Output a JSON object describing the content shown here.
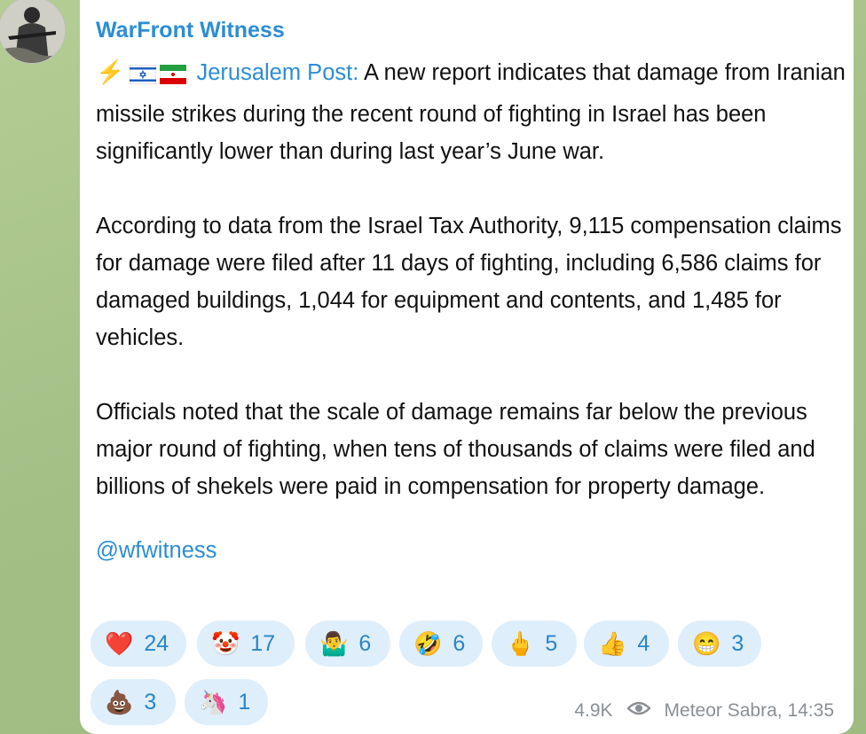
{
  "channel": {
    "name": "WarFront Witness"
  },
  "post": {
    "bolt": "⚡",
    "source": "Jerusalem Post:",
    "p1_rest": " A new report indicates that damage from Iranian missile strikes during the recent round of fighting in Israel has been significantly lower than during last year’s June war.",
    "p2": "According to data from the Israel Tax Authority, 9,115 compensation claims for damage were filed after 11 days of fighting, including 6,586 claims for damaged buildings, 1,044 for equipment and contents, and 1,485 for vehicles.",
    "p3": "Officials noted that the scale of damage remains far below the previous major round of fighting, when tens of thousands of claims were filed and billions of shekels were paid in compensation for property damage.",
    "handle": "@wfwitness"
  },
  "reactions": [
    {
      "emoji": "❤️",
      "count": "24"
    },
    {
      "emoji": "🤡",
      "count": "17"
    },
    {
      "emoji": "🤷‍♂️",
      "count": "6"
    },
    {
      "emoji": "🤣",
      "count": "6"
    },
    {
      "emoji": "🖕",
      "count": "5"
    },
    {
      "emoji": "👍",
      "count": "4"
    },
    {
      "emoji": "😁",
      "count": "3"
    },
    {
      "emoji": "💩",
      "count": "3"
    },
    {
      "emoji": "🦄",
      "count": "1"
    }
  ],
  "meta": {
    "views": "4.9K",
    "author_time": "Meteor Sabra, 14:35"
  },
  "colors": {
    "accent": "#2c8dd3",
    "reaction_bg": "#deeefb",
    "wallpaper": "#a9c48c"
  }
}
